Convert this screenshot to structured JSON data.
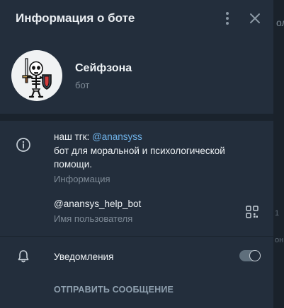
{
  "background": {
    "fragment_1": "ол",
    "fragment_2": "1",
    "fragment_3": "он"
  },
  "header": {
    "title": "Информация о боте",
    "more_icon": "more-vertical-icon",
    "close_icon": "close-icon"
  },
  "profile": {
    "avatar_icon": "skeleton-knight-avatar",
    "name": "Сейфзона",
    "subtitle": "бот"
  },
  "info": {
    "icon": "info-icon",
    "bio_prefix": "наш тгк: ",
    "bio_link": "@anansyss",
    "bio_line2": "бот для моральной и психологической",
    "bio_line3": "помощи.",
    "bio_label": "Информация",
    "username": "@anansys_help_bot",
    "username_label": "Имя пользователя",
    "qr_icon": "qr-code-icon"
  },
  "notifications": {
    "icon": "bell-icon",
    "label": "Уведомления",
    "enabled": true
  },
  "actions": {
    "send_message": "ОТПРАВИТЬ СООБЩЕНИЕ"
  },
  "colors": {
    "panel": "#232e3c",
    "accent_link": "#6fb3ea",
    "text": "#eef2f5",
    "muted": "#7f8b97"
  }
}
